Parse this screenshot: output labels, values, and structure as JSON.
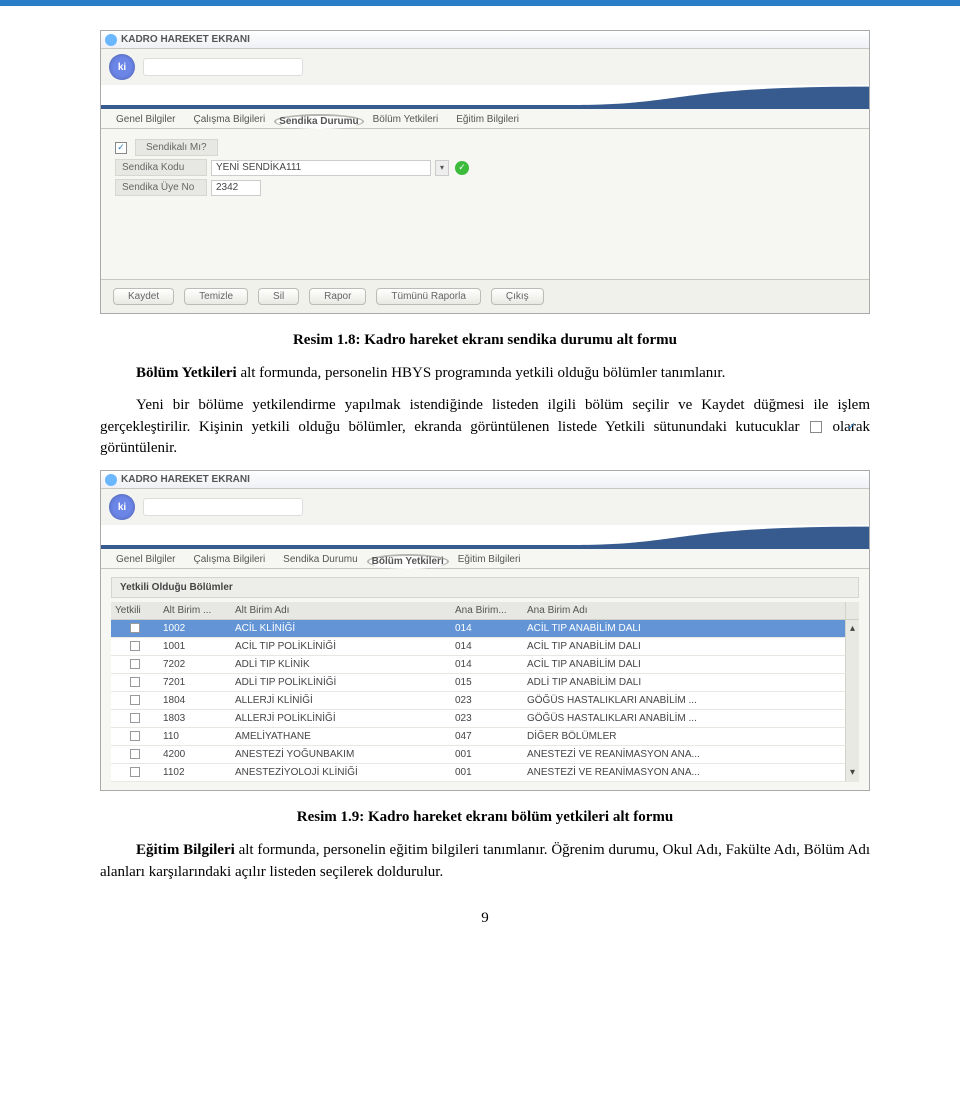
{
  "screenshot1": {
    "window_title": "KADRO HAREKET EKRANI",
    "avatar_text": "ki",
    "tabs": [
      "Genel Bilgiler",
      "Çalışma Bilgileri",
      "Sendika Durumu",
      "Bölüm Yetkileri",
      "Eğitim Bilgileri"
    ],
    "active_tab_index": 2,
    "form": {
      "sendikali_label": "Sendikalı Mı?",
      "sendikali_checked": true,
      "kodu_label": "Sendika Kodu",
      "kodu_value": "YENİ SENDİKA111",
      "uye_label": "Sendika Üye No",
      "uye_value": "2342"
    },
    "buttons": [
      "Kaydet",
      "Temizle",
      "Sil",
      "Rapor",
      "Tümünü Raporla",
      "Çıkış"
    ]
  },
  "caption1": "Resim 1.8: Kadro hareket ekranı sendika durumu alt formu",
  "para1": "Bölüm Yetkileri alt formunda, personelin HBYS programında yetkili olduğu bölümler tanımlanır.",
  "para2a": "Yeni bir bölüme yetkilendirme yapılmak istendiğinde listeden ilgili bölüm seçilir ve Kaydet düğmesi ile işlem gerçekleştirilir. Kişinin yetkili olduğu bölümler, ekranda görüntülenen listede Yetkili sütunundaki kutucuklar ",
  "para2b": " olarak görüntülenir.",
  "screenshot2": {
    "window_title": "KADRO HAREKET EKRANI",
    "avatar_text": "ki",
    "tabs": [
      "Genel Bilgiler",
      "Çalışma Bilgileri",
      "Sendika Durumu",
      "Bölüm Yetkileri",
      "Eğitim Bilgileri"
    ],
    "active_tab_index": 3,
    "grid_title": "Yetkili Olduğu Bölümler",
    "columns": [
      "Yetkili",
      "Alt Birim ...",
      "Alt Birim Adı",
      "Ana Birim...",
      "Ana Birim Adı"
    ],
    "rows": [
      {
        "alt_kod": "1002",
        "alt_ad": "ACİL KLİNİĞİ",
        "ana_kod": "014",
        "ana_ad": "ACİL TIP ANABİLİM DALI",
        "selected": true
      },
      {
        "alt_kod": "1001",
        "alt_ad": "ACİL TIP POLİKLİNİĞİ",
        "ana_kod": "014",
        "ana_ad": "ACİL TIP ANABİLİM DALI"
      },
      {
        "alt_kod": "7202",
        "alt_ad": "ADLİ TIP KLİNİK",
        "ana_kod": "014",
        "ana_ad": "ACİL TIP ANABİLİM DALI"
      },
      {
        "alt_kod": "7201",
        "alt_ad": "ADLİ TIP POLİKLİNİĞİ",
        "ana_kod": "015",
        "ana_ad": "ADLİ TIP ANABİLİM DALI"
      },
      {
        "alt_kod": "1804",
        "alt_ad": "ALLERJİ KLİNİĞİ",
        "ana_kod": "023",
        "ana_ad": "GÖĞÜS HASTALIKLARI ANABİLİM ..."
      },
      {
        "alt_kod": "1803",
        "alt_ad": "ALLERJİ POLİKLİNİĞİ",
        "ana_kod": "023",
        "ana_ad": "GÖĞÜS HASTALIKLARI ANABİLİM ..."
      },
      {
        "alt_kod": "110",
        "alt_ad": "AMELİYATHANE",
        "ana_kod": "047",
        "ana_ad": "DİĞER BÖLÜMLER"
      },
      {
        "alt_kod": "4200",
        "alt_ad": "ANESTEZİ YOĞUNBAKIM",
        "ana_kod": "001",
        "ana_ad": "ANESTEZİ VE REANİMASYON ANA..."
      },
      {
        "alt_kod": "1102",
        "alt_ad": "ANESTEZİYOLOJİ KLİNİĞİ",
        "ana_kod": "001",
        "ana_ad": "ANESTEZİ VE REANİMASYON ANA..."
      }
    ]
  },
  "caption2": "Resim 1.9: Kadro hareket ekranı bölüm yetkileri alt formu",
  "para3": "Eğitim Bilgileri alt formunda, personelin eğitim bilgileri tanımlanır. Öğrenim durumu, Okul Adı, Fakülte Adı, Bölüm Adı alanları karşılarındaki açılır listeden seçilerek doldurulur.",
  "page_number": "9"
}
